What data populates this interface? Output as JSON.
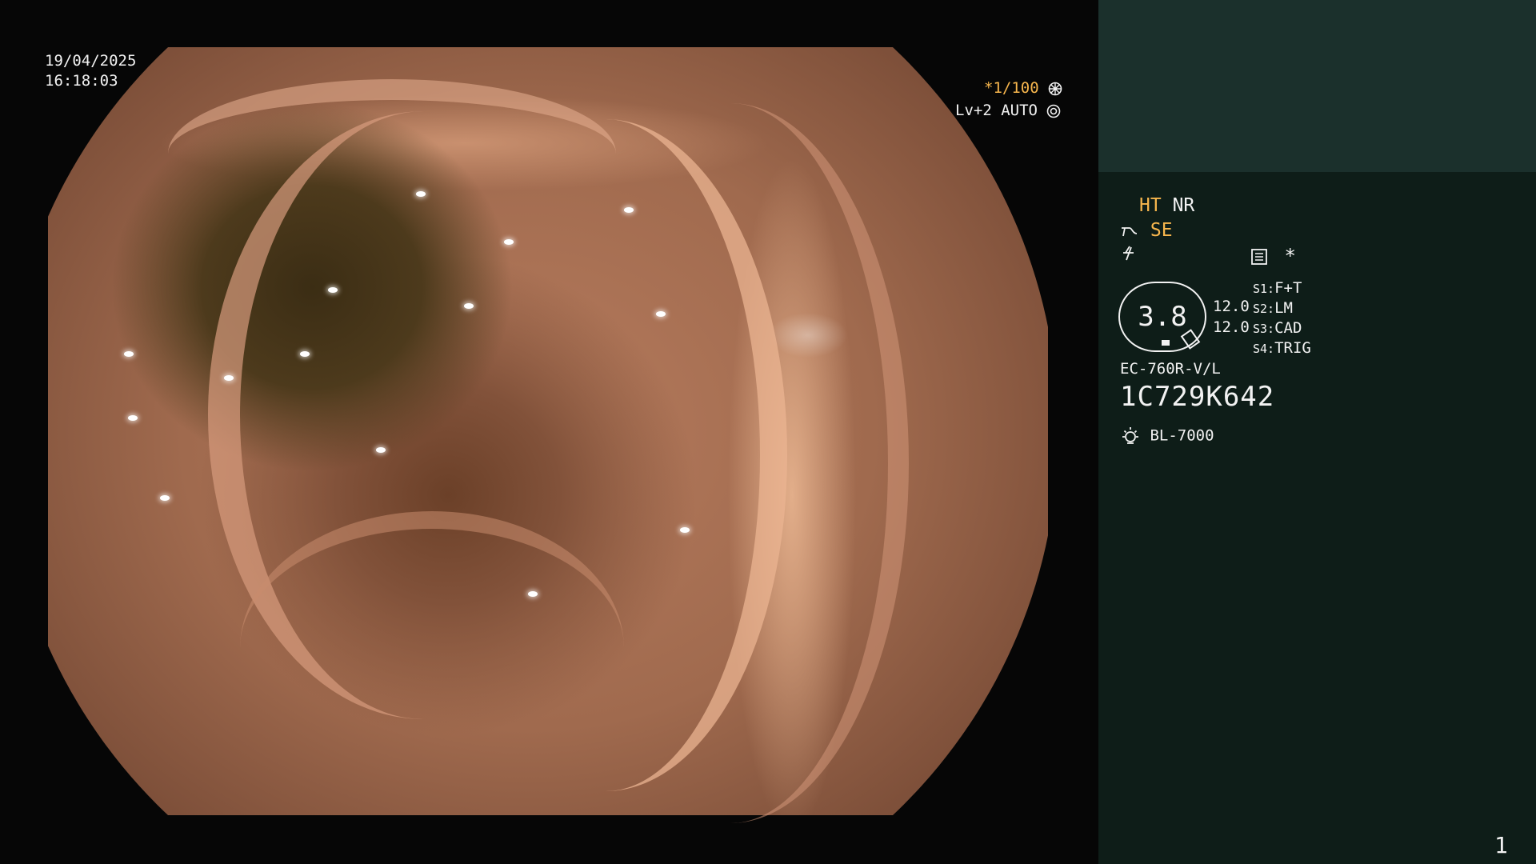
{
  "overlay": {
    "date": "19/04/2025",
    "time": "16:18:03",
    "shutter": "*1/100",
    "level": "Lv+2 AUTO"
  },
  "panel": {
    "ht": "HT",
    "nr": "NR",
    "se": "SE",
    "star": "*",
    "gauge_value": "3.8",
    "val1": "12.0",
    "val2": "12.0",
    "s1_key": "S1:",
    "s1": "F+T",
    "s2_key": "S2:",
    "s2": "LM",
    "s3_key": "S3:",
    "s3": "CAD",
    "s4_key": "S4:",
    "s4": "TRIG",
    "scope_model": "EC-760R-V/L",
    "serial": "1C729K642",
    "light_source": "BL-7000",
    "page": "1"
  },
  "icons": {
    "shutter": "aperture-icon",
    "level": "auto-iris-icon",
    "enhance": "structure-enhance-icon",
    "color": "color-mode-icon",
    "memo": "memo-icon",
    "light": "lamp-icon"
  },
  "colors": {
    "accent": "#f7b64d",
    "panel_bg": "#0e1d18",
    "panel_top": "#1b302c"
  }
}
